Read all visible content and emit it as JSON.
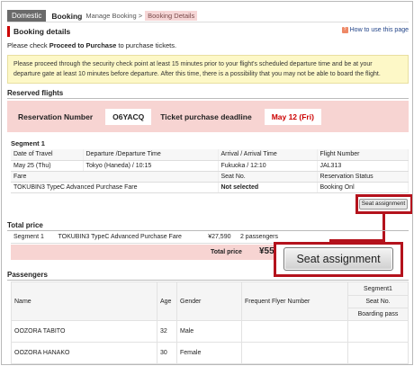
{
  "breadcrumb": {
    "domestic": "Domestic",
    "booking": "Booking",
    "manage": "Manage Booking >",
    "details": "Booking Details"
  },
  "booking_details": {
    "title": "Booking details",
    "howto": "How to use this page",
    "instruction_prefix": "Please check ",
    "instruction_bold": "Proceed to Purchase",
    "instruction_suffix": " to purchase tickets.",
    "note_line1": "Please proceed through the security check point at least 15 minutes prior to your flight's scheduled departure time and be at your",
    "note_line2": "departure gate at least 10 minutes before departure. After this time, there is a possibility that you may not be able to board the flight."
  },
  "reserved": {
    "title": "Reserved flights",
    "reservation_label": "Reservation Number",
    "reservation_number": "O6YACQ",
    "deadline_label": "Ticket purchase deadline",
    "deadline": "May 12 (Fri)"
  },
  "segment": {
    "title": "Segment 1",
    "headers": [
      "Date of Travel",
      "Departure /Departure Time",
      "Arrival / Arrival Time",
      "Flight Number"
    ],
    "row": [
      "May 25 (Thu)",
      "Tokyo (Haneda) / 10:15",
      "Fukuoka / 12:10",
      "JAL313"
    ],
    "headers2": [
      "Fare",
      "Seat No.",
      "Reservation Status"
    ],
    "row2": [
      "TOKUBIN3 TypeC Advanced Purchase Fare",
      "Not selected",
      "Booking Onl"
    ],
    "seat_button_small": "Seat assignment"
  },
  "price": {
    "title": "Total price",
    "segment": "Segment 1",
    "fare": "TOKUBIN3 TypeC Advanced Purchase Fare",
    "amount": "¥27,590",
    "passengers": "2 passengers",
    "total_label": "Total price",
    "total_amount": "¥55"
  },
  "seat_button_large": "Seat assignment",
  "passengers": {
    "title": "Passengers",
    "headers": [
      "Name",
      "Age",
      "Gender",
      "Frequent Flyer Number",
      "Segment1"
    ],
    "sub1": "Seat No.",
    "sub2": "Boarding pass",
    "rows": [
      {
        "name": "OOZORA TABITO",
        "age": "32",
        "gender": "Male"
      },
      {
        "name": "OOZORA HANAKO",
        "age": "30",
        "gender": "Female"
      }
    ]
  }
}
